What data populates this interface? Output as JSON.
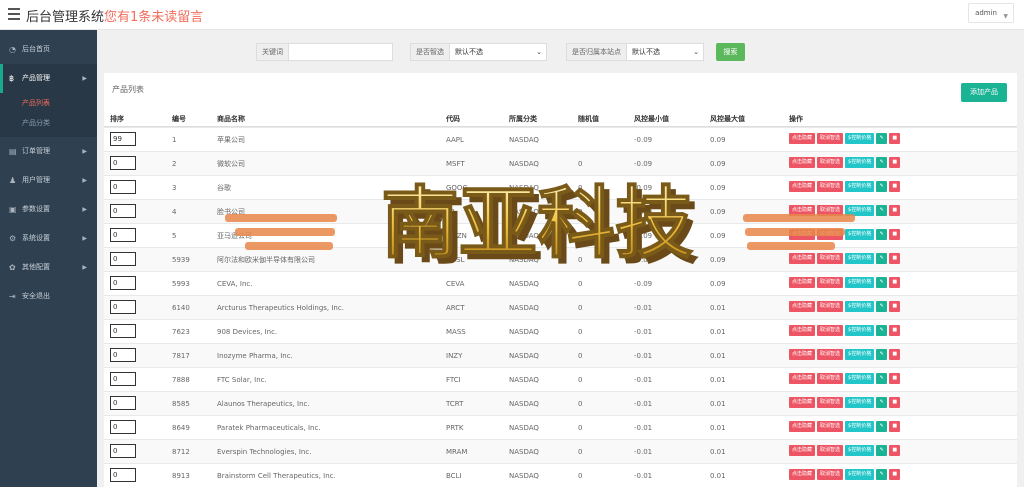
{
  "header": {
    "title": "后台管理系统",
    "notice": "您有1条未读留言",
    "user": "admin"
  },
  "sidebar": {
    "items": [
      {
        "label": "后台首页",
        "icon": "dashboard-icon"
      },
      {
        "label": "产品管理",
        "icon": "product-icon",
        "active": true,
        "sub": [
          {
            "label": "产品列表",
            "active": true
          },
          {
            "label": "产品分类"
          }
        ]
      },
      {
        "label": "订单管理",
        "icon": "order-icon"
      },
      {
        "label": "用户管理",
        "icon": "user-icon"
      },
      {
        "label": "参数设置",
        "icon": "params-icon"
      },
      {
        "label": "系统设置",
        "icon": "settings-icon"
      },
      {
        "label": "其他配置",
        "icon": "gear-icon"
      },
      {
        "label": "安全退出",
        "icon": "logout-icon"
      }
    ]
  },
  "search": {
    "keyword_label": "关键词",
    "keyword_value": "",
    "smart_label": "是否智选",
    "smart_value": "默认不选",
    "home_label": "是否归属本站点",
    "home_value": "默认不选",
    "button": "搜索"
  },
  "panel": {
    "title": "产品列表",
    "add_button": "添加产品"
  },
  "table": {
    "headers": [
      "排序",
      "编号",
      "商品名称",
      "代码",
      "所属分类",
      "随机值",
      "风控最小值",
      "风控最大值",
      "操作"
    ],
    "actions": {
      "hide": "点击隐藏",
      "cancel_smart": "取消智选",
      "price_control": "$控制价格"
    },
    "rows": [
      {
        "sort": "99",
        "id": "1",
        "name": "苹果公司",
        "code": "AAPL",
        "cat": "NASDAQ",
        "rand": "",
        "min": "-0.09",
        "max": "0.09"
      },
      {
        "sort": "0",
        "id": "2",
        "name": "微软公司",
        "code": "MSFT",
        "cat": "NASDAQ",
        "rand": "0",
        "min": "-0.09",
        "max": "0.09"
      },
      {
        "sort": "0",
        "id": "3",
        "name": "谷歌",
        "code": "GOOG",
        "cat": "NASDAQ",
        "rand": "0",
        "min": "-0.09",
        "max": "0.09"
      },
      {
        "sort": "0",
        "id": "4",
        "name": "脸书公司",
        "code": "FB",
        "cat": "NASDAQ",
        "rand": "0",
        "min": "-0.09",
        "max": "0.09"
      },
      {
        "sort": "0",
        "id": "5",
        "name": "亚马逊公司",
        "code": "AMZN",
        "cat": "NASDAQ",
        "rand": "0",
        "min": "-0.09",
        "max": "0.09"
      },
      {
        "sort": "0",
        "id": "5939",
        "name": "阿尔法和欧米伽半导体有限公司",
        "code": "AOSL",
        "cat": "NASDAQ",
        "rand": "0",
        "min": "-0.09",
        "max": "0.09"
      },
      {
        "sort": "0",
        "id": "5993",
        "name": "CEVA, Inc.",
        "code": "CEVA",
        "cat": "NASDAQ",
        "rand": "0",
        "min": "-0.09",
        "max": "0.09"
      },
      {
        "sort": "0",
        "id": "6140",
        "name": "Arcturus Therapeutics Holdings, Inc.",
        "code": "ARCT",
        "cat": "NASDAQ",
        "rand": "0",
        "min": "-0.01",
        "max": "0.01"
      },
      {
        "sort": "0",
        "id": "7623",
        "name": "908 Devices, Inc.",
        "code": "MASS",
        "cat": "NASDAQ",
        "rand": "0",
        "min": "-0.01",
        "max": "0.01"
      },
      {
        "sort": "0",
        "id": "7817",
        "name": "Inozyme Pharma, Inc.",
        "code": "INZY",
        "cat": "NASDAQ",
        "rand": "0",
        "min": "-0.01",
        "max": "0.01"
      },
      {
        "sort": "0",
        "id": "7888",
        "name": "FTC Solar, Inc.",
        "code": "FTCI",
        "cat": "NASDAQ",
        "rand": "0",
        "min": "-0.01",
        "max": "0.01"
      },
      {
        "sort": "0",
        "id": "8585",
        "name": "Alaunos Therapeutics, Inc.",
        "code": "TCRT",
        "cat": "NASDAQ",
        "rand": "0",
        "min": "-0.01",
        "max": "0.01"
      },
      {
        "sort": "0",
        "id": "8649",
        "name": "Paratek Pharmaceuticals, Inc.",
        "code": "PRTK",
        "cat": "NASDAQ",
        "rand": "0",
        "min": "-0.01",
        "max": "0.01"
      },
      {
        "sort": "0",
        "id": "8712",
        "name": "Everspin Technologies, Inc.",
        "code": "MRAM",
        "cat": "NASDAQ",
        "rand": "0",
        "min": "-0.01",
        "max": "0.01"
      },
      {
        "sort": "0",
        "id": "8913",
        "name": "Brainstorm Cell Therapeutics, Inc.",
        "code": "BCLI",
        "cat": "NASDAQ",
        "rand": "0",
        "min": "-0.01",
        "max": "0.01"
      }
    ]
  },
  "watermark": {
    "text": "南亚科技"
  },
  "colors": {
    "sidebar": "#2f4050",
    "accent": "#1ab394",
    "danger": "#ed5565",
    "info": "#23c6c8",
    "notice": "#f26d5b",
    "search": "#5cb85c"
  }
}
